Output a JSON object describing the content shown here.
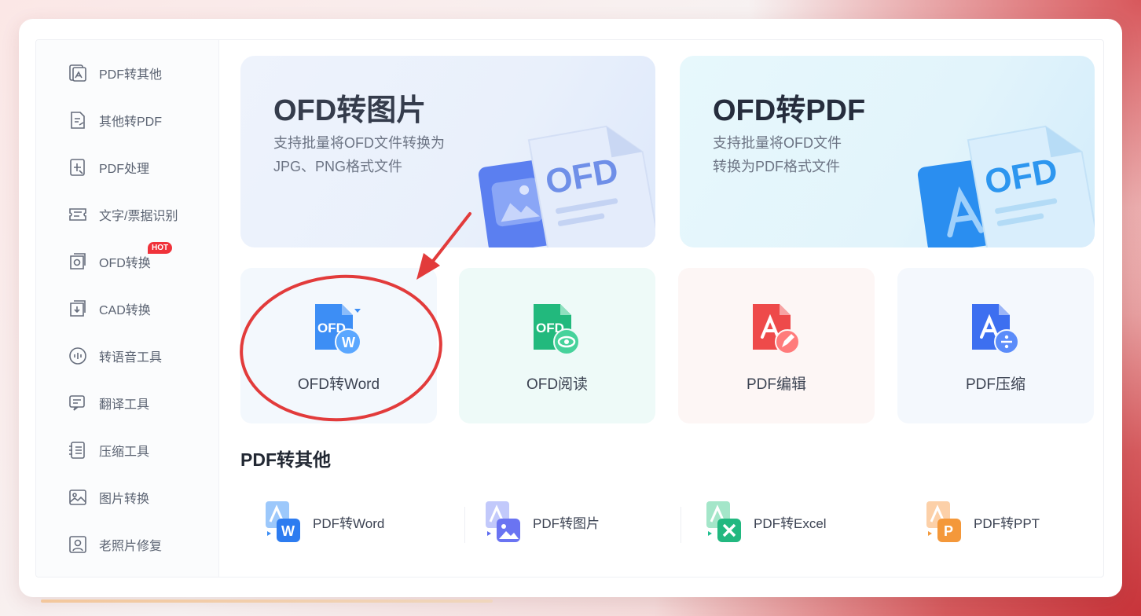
{
  "sidebar": {
    "items": [
      {
        "label": "PDF转其他",
        "icon": "pdf-image-icon"
      },
      {
        "label": "其他转PDF",
        "icon": "file-export-icon"
      },
      {
        "label": "PDF处理",
        "icon": "pdf-process-icon"
      },
      {
        "label": "文字/票据识别",
        "icon": "ocr-ticket-icon"
      },
      {
        "label": "OFD转换",
        "icon": "ofd-convert-icon",
        "badge": "HOT"
      },
      {
        "label": "CAD转换",
        "icon": "cad-convert-icon"
      },
      {
        "label": "转语音工具",
        "icon": "speech-icon"
      },
      {
        "label": "翻译工具",
        "icon": "translate-icon"
      },
      {
        "label": "压缩工具",
        "icon": "compress-icon"
      },
      {
        "label": "图片转换",
        "icon": "image-convert-icon"
      },
      {
        "label": "老照片修复",
        "icon": "photo-restore-icon"
      }
    ]
  },
  "banners": [
    {
      "title": "OFD转图片",
      "desc_line1": "支持批量将OFD文件转换为",
      "desc_line2": "JPG、PNG格式文件",
      "art_text": "OFD"
    },
    {
      "title": "OFD转PDF",
      "desc_line1": "支持批量将OFD文件",
      "desc_line2": "转换为PDF格式文件",
      "art_text": "OFD"
    }
  ],
  "tiles": [
    {
      "label": "OFD转Word",
      "icon_text": "OFD",
      "badge_text": "W"
    },
    {
      "label": "OFD阅读",
      "icon_text": "OFD"
    },
    {
      "label": "PDF编辑"
    },
    {
      "label": "PDF压缩"
    }
  ],
  "section": {
    "title": "PDF转其他"
  },
  "tools": [
    {
      "label": "PDF转Word",
      "badge_text": "W"
    },
    {
      "label": "PDF转图片"
    },
    {
      "label": "PDF转Excel"
    },
    {
      "label": "PDF转PPT",
      "badge_text": "P"
    }
  ],
  "colors": {
    "accent_red": "#e23b3b",
    "hot_badge": "#f0323a",
    "word_blue": "#2d7cf0",
    "ofd_green": "#1fbf8f"
  }
}
